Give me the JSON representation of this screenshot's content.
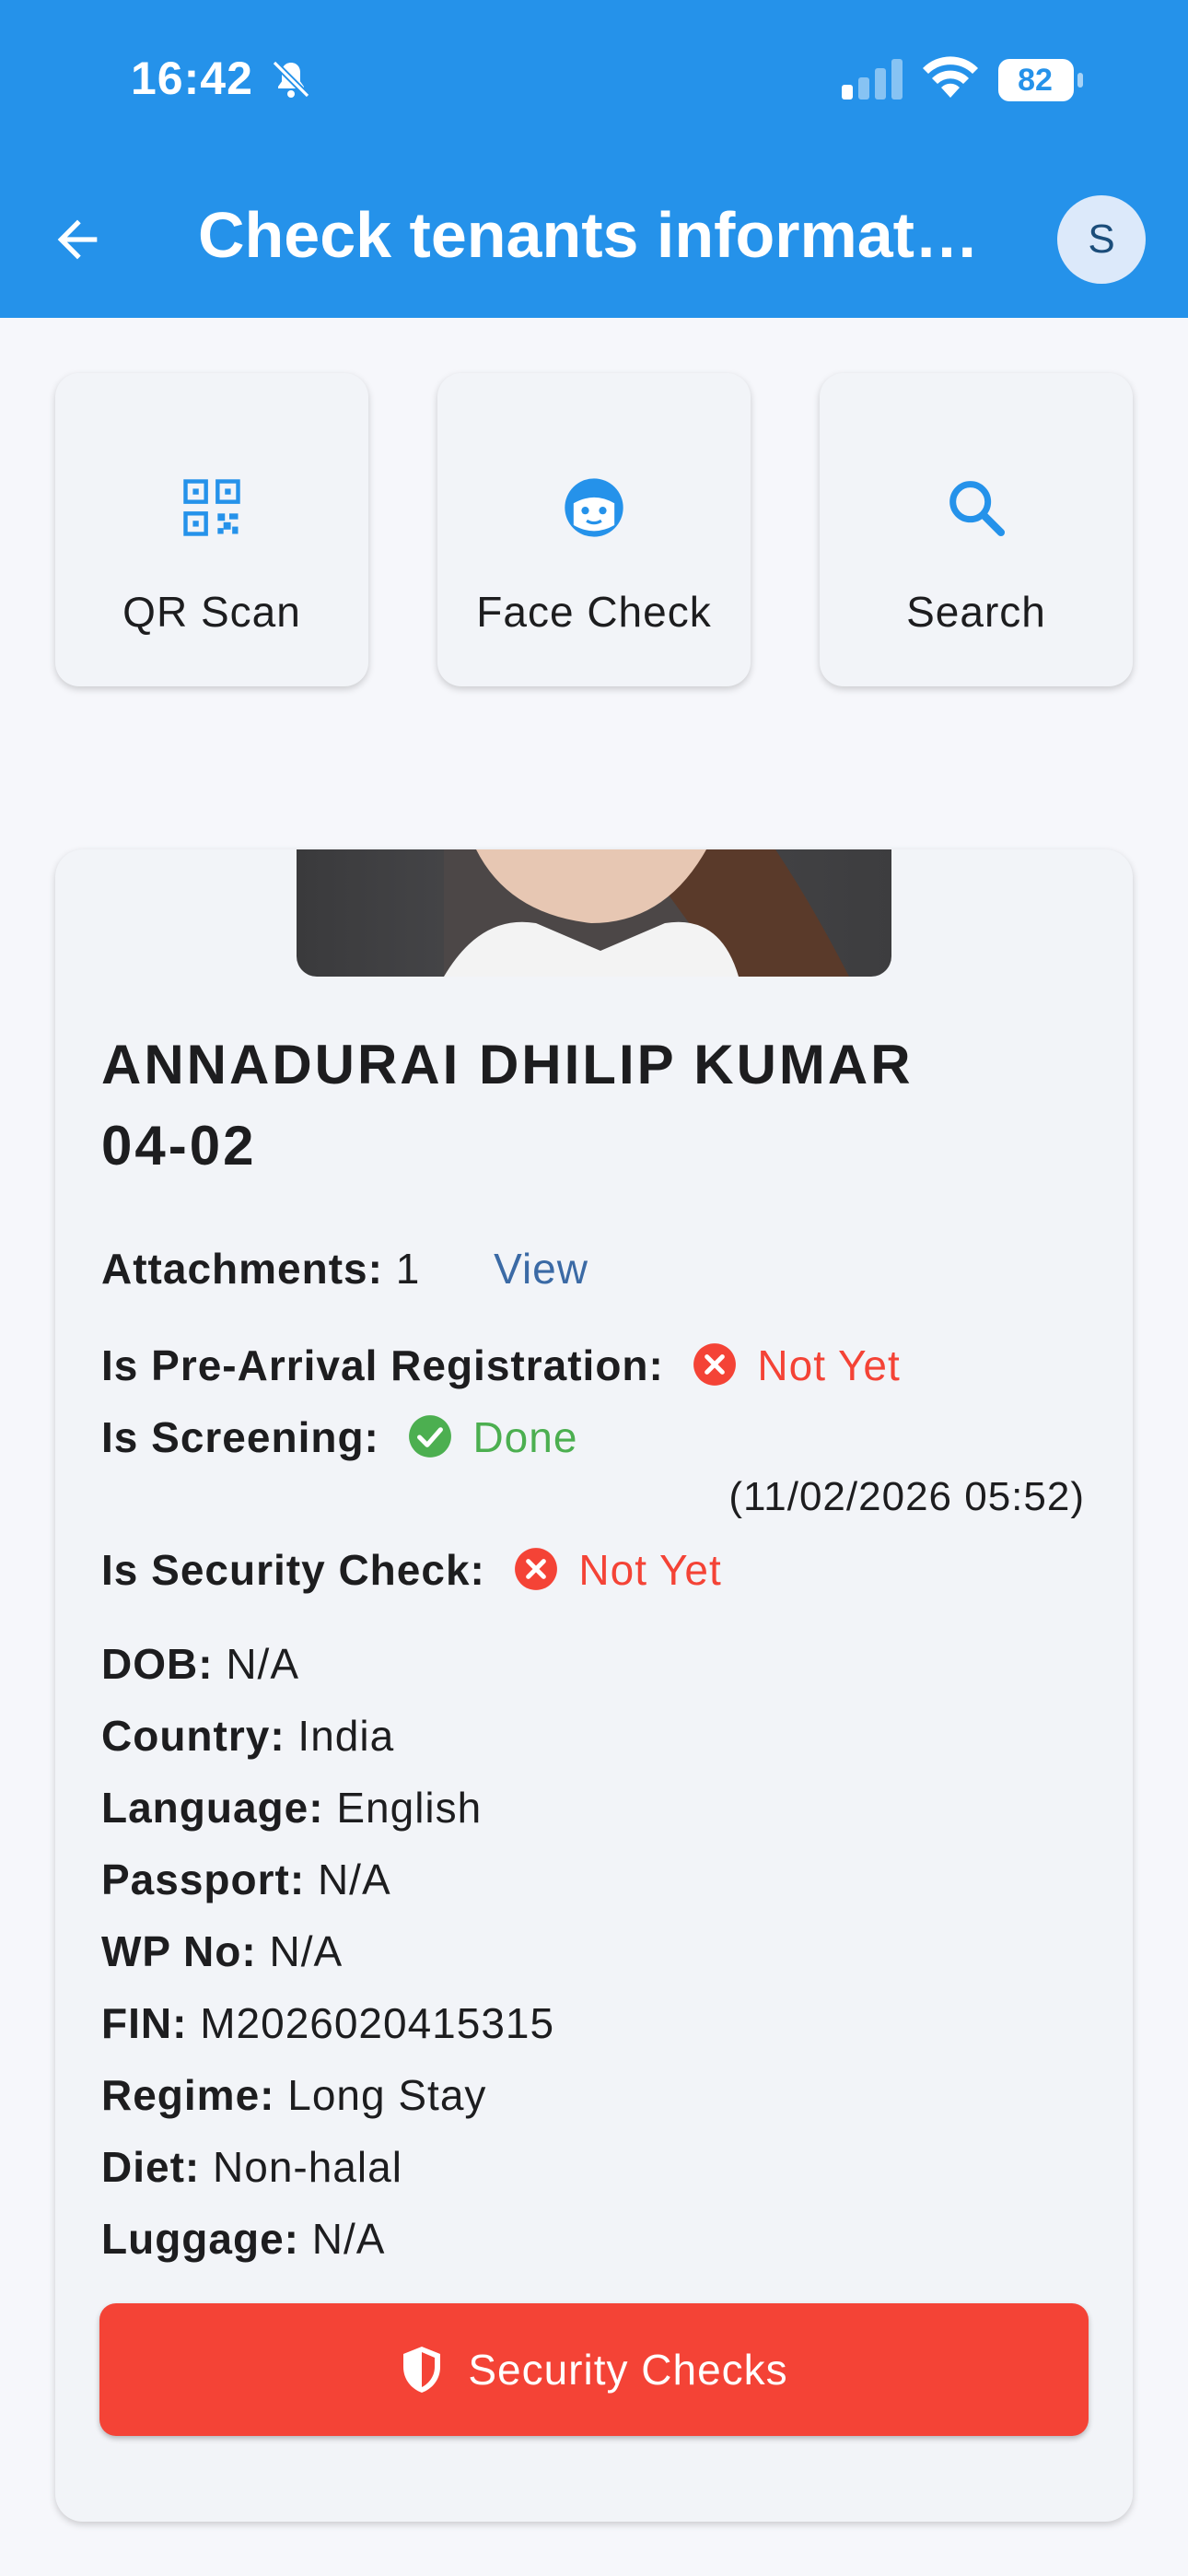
{
  "status_bar": {
    "time": "16:42",
    "battery": "82"
  },
  "header": {
    "title": "Check tenants informati…",
    "avatar_initial": "S"
  },
  "actions": [
    {
      "label": "QR Scan",
      "icon": "qr-code-icon"
    },
    {
      "label": "Face Check",
      "icon": "face-icon"
    },
    {
      "label": "Search",
      "icon": "search-icon"
    }
  ],
  "tenant": {
    "name": "ANNADURAI DHILIP KUMAR",
    "unit": "04-02",
    "attachments_label": "Attachments:",
    "attachments_count": "1",
    "view_label": "View",
    "pre_arrival_label": "Is Pre-Arrival Registration:",
    "pre_arrival_value": "Not Yet",
    "screening_label": "Is Screening:",
    "screening_value": "Done",
    "screening_time": "(11/02/2026 05:52)",
    "security_label": "Is Security Check:",
    "security_value": "Not Yet",
    "details": [
      {
        "label": "DOB:",
        "value": "N/A"
      },
      {
        "label": "Country:",
        "value": "India"
      },
      {
        "label": "Language:",
        "value": "English"
      },
      {
        "label": "Passport:",
        "value": "N/A"
      },
      {
        "label": "WP No:",
        "value": "N/A"
      },
      {
        "label": "FIN:",
        "value": "M2026020415315"
      },
      {
        "label": "Regime:",
        "value": "Long Stay"
      },
      {
        "label": "Diet:",
        "value": "Non-halal"
      },
      {
        "label": "Luggage:",
        "value": "N/A"
      }
    ],
    "security_button": "Security Checks"
  },
  "colors": {
    "primary": "#2592ea",
    "danger": "#f44336",
    "success": "#4caf50",
    "link": "#3b6aa5"
  }
}
